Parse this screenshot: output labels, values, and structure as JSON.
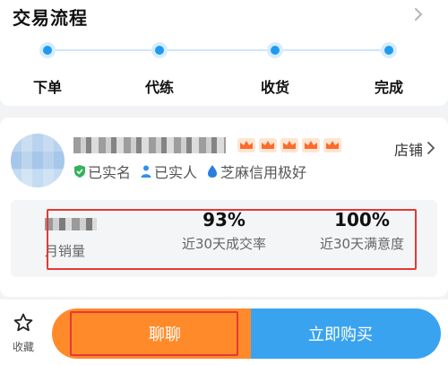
{
  "process": {
    "title": "交易流程",
    "steps": [
      "下单",
      "代练",
      "收货",
      "完成"
    ],
    "accent": "#1d9bf0"
  },
  "shop": {
    "crown_count": 5,
    "link_label": "店铺",
    "badges": [
      {
        "icon": "shield-check-icon",
        "label": "已实名"
      },
      {
        "icon": "person-icon",
        "label": "已实人"
      },
      {
        "icon": "sesame-drop-icon",
        "label": "芝麻信用极好"
      }
    ],
    "stats": [
      {
        "value": "",
        "label": "月销量"
      },
      {
        "value": "93%",
        "label": "近30天成交率"
      },
      {
        "value": "100%",
        "label": "近30天满意度"
      }
    ],
    "highlight_color": "#e53935"
  },
  "bottom": {
    "fav_label": "收藏",
    "chat_label": "聊聊",
    "buy_label": "立即购买",
    "chat_color": "#ff8a2a",
    "buy_color": "#3aa3f0"
  }
}
